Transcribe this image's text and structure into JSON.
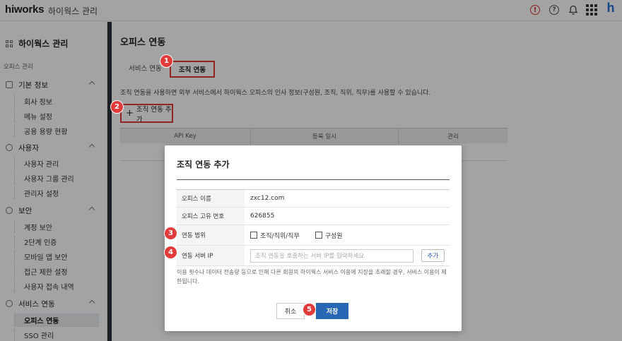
{
  "topbar": {
    "logo": "hiworks",
    "app_name": "하이웍스 관리",
    "alert_glyph": "!",
    "help_glyph": "?",
    "brand_glyph": "h"
  },
  "sidebar": {
    "title": "하이웍스 관리",
    "caption": "오피스 관리",
    "sections": [
      {
        "label": "기본 정보",
        "items": [
          "회사 정보",
          "메뉴 설정",
          "공용 용량 현황"
        ]
      },
      {
        "label": "사용자",
        "items": [
          "사용자 관리",
          "사용자 그룹 관리",
          "관리자 설정"
        ]
      },
      {
        "label": "보안",
        "items": [
          "계정 보안",
          "2단계 인증",
          "모바일 앱 보안",
          "접근 제한 설정",
          "사용자 접속 내역"
        ]
      },
      {
        "label": "서비스 연동",
        "items": [
          "오피스 연동",
          "SSO 관리"
        ]
      }
    ],
    "active_item": "오피스 연동"
  },
  "page": {
    "title": "오피스 연동",
    "tabs": [
      "서비스 연동",
      "조직 연동"
    ],
    "active_tab": "조직 연동",
    "description": "조직 연동을 사용하면 외부 서비스에서 하이웍스 오피스의 인사 정보(구성원, 조직, 직위, 직무)를 사용할 수 있습니다.",
    "add_button": "조직 연동 추가",
    "table_headers": [
      "API Key",
      "등록 일시",
      "관리"
    ]
  },
  "modal": {
    "title": "조직 연동 추가",
    "rows": {
      "office_name_label": "오피스 이름",
      "office_name_value": "zxc12.com",
      "office_id_label": "오피스 고유 번호",
      "office_id_value": "626855",
      "scope_label": "연동 범위",
      "scope_option1": "조직/직위/직무",
      "scope_option2": "구성원",
      "ip_label": "연동 서버 IP",
      "ip_placeholder": "조직 연동을 호출하는 서버 IP를 입력하세요",
      "ip_add": "추가"
    },
    "notice": "이용 횟수나 데이터 전송량 등으로 인해 다른 회원의 하이웍스 서비스 이용에 지장을 초래할 경우, 서비스 이용이 제한됩니다.",
    "cancel": "취소",
    "save": "저장"
  },
  "badges": [
    "1",
    "2",
    "3",
    "4",
    "5"
  ],
  "colors": {
    "highlight_red": "#e23b3b",
    "primary_blue": "#2767b4",
    "brand_blue": "#1f6fd1"
  }
}
